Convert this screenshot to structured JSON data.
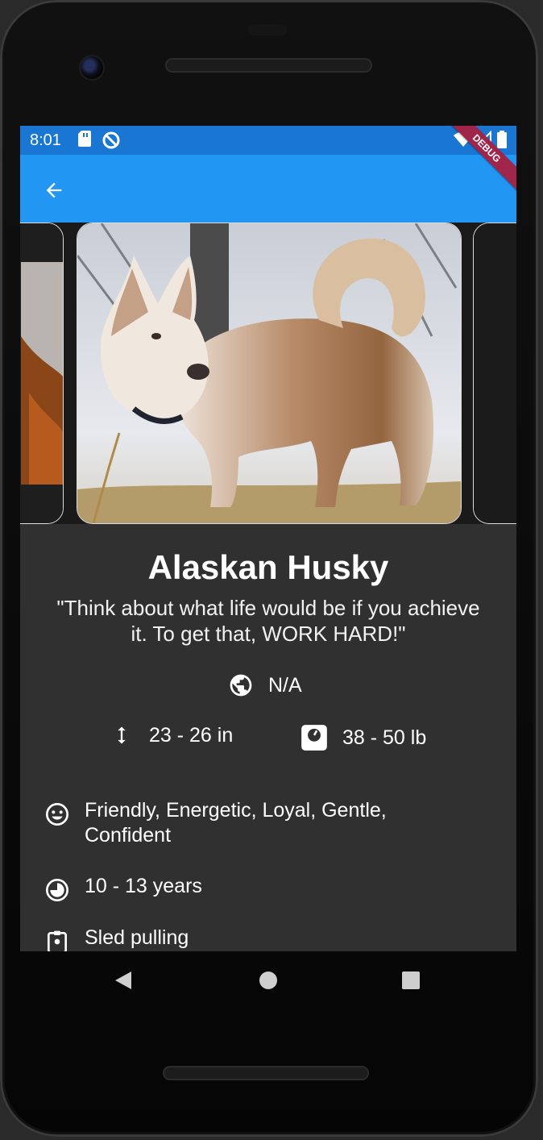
{
  "status_bar": {
    "time": "8:01",
    "icons": [
      "sd-card-icon",
      "do-not-disturb-icon",
      "wifi-icon",
      "signal-icon",
      "battery-icon"
    ],
    "debug_banner": "DEBUG"
  },
  "app_bar": {
    "back_icon": "arrow-back-icon",
    "color": "#2196f3"
  },
  "carousel": {
    "images": [
      "previous-dog-image",
      "alaskan-husky-image",
      "next-dog-image"
    ]
  },
  "breed": {
    "name": "Alaskan Husky",
    "quote": "\"Think about what life would be if you achieve it. To get that, WORK HARD!\"",
    "origin": "N/A",
    "height": "23 - 26 in",
    "weight": "38 - 50 lb",
    "temperament": "Friendly, Energetic, Loyal, Gentle, Confident",
    "life_span": "10 - 13 years",
    "bred_for": "Sled pulling"
  },
  "nav_bar": {
    "buttons": [
      "back-triangle-icon",
      "home-circle-icon",
      "recents-square-icon"
    ]
  }
}
